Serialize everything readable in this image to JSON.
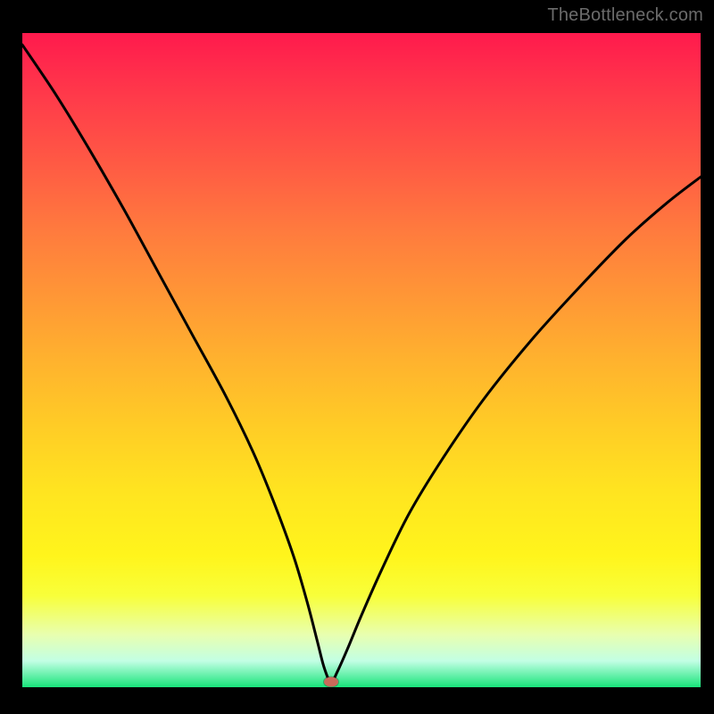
{
  "watermark": "TheBottleneck.com",
  "chart_data": {
    "type": "line",
    "note": "Axes are unlabeled; values are normalized 0-100 on both axes estimated from pixel positions.",
    "xlabel": "",
    "ylabel": "",
    "xlim": [
      0,
      100
    ],
    "ylim": [
      0,
      100
    ],
    "series": [
      {
        "name": "curve",
        "points": [
          {
            "x": 0.0,
            "y": 98.2
          },
          {
            "x": 5.0,
            "y": 90.5
          },
          {
            "x": 10.0,
            "y": 82.0
          },
          {
            "x": 15.0,
            "y": 73.0
          },
          {
            "x": 20.0,
            "y": 63.5
          },
          {
            "x": 25.0,
            "y": 54.0
          },
          {
            "x": 30.0,
            "y": 44.5
          },
          {
            "x": 34.0,
            "y": 36.0
          },
          {
            "x": 37.0,
            "y": 28.5
          },
          {
            "x": 40.0,
            "y": 20.0
          },
          {
            "x": 42.0,
            "y": 13.0
          },
          {
            "x": 43.5,
            "y": 7.0
          },
          {
            "x": 44.5,
            "y": 3.0
          },
          {
            "x": 45.5,
            "y": 0.8
          },
          {
            "x": 46.5,
            "y": 2.5
          },
          {
            "x": 48.0,
            "y": 6.0
          },
          {
            "x": 50.0,
            "y": 11.0
          },
          {
            "x": 53.0,
            "y": 18.0
          },
          {
            "x": 57.0,
            "y": 26.5
          },
          {
            "x": 62.0,
            "y": 35.0
          },
          {
            "x": 68.0,
            "y": 44.0
          },
          {
            "x": 75.0,
            "y": 53.0
          },
          {
            "x": 82.0,
            "y": 61.0
          },
          {
            "x": 89.0,
            "y": 68.5
          },
          {
            "x": 95.0,
            "y": 74.0
          },
          {
            "x": 100.0,
            "y": 78.0
          }
        ]
      }
    ],
    "marker": {
      "x": 45.5,
      "y": 0.8
    },
    "gradient_stops": [
      {
        "pos": 0.0,
        "color": "#ff1a4d"
      },
      {
        "pos": 0.5,
        "color": "#ffb22e"
      },
      {
        "pos": 0.8,
        "color": "#fff51c"
      },
      {
        "pos": 1.0,
        "color": "#18e47a"
      }
    ]
  }
}
